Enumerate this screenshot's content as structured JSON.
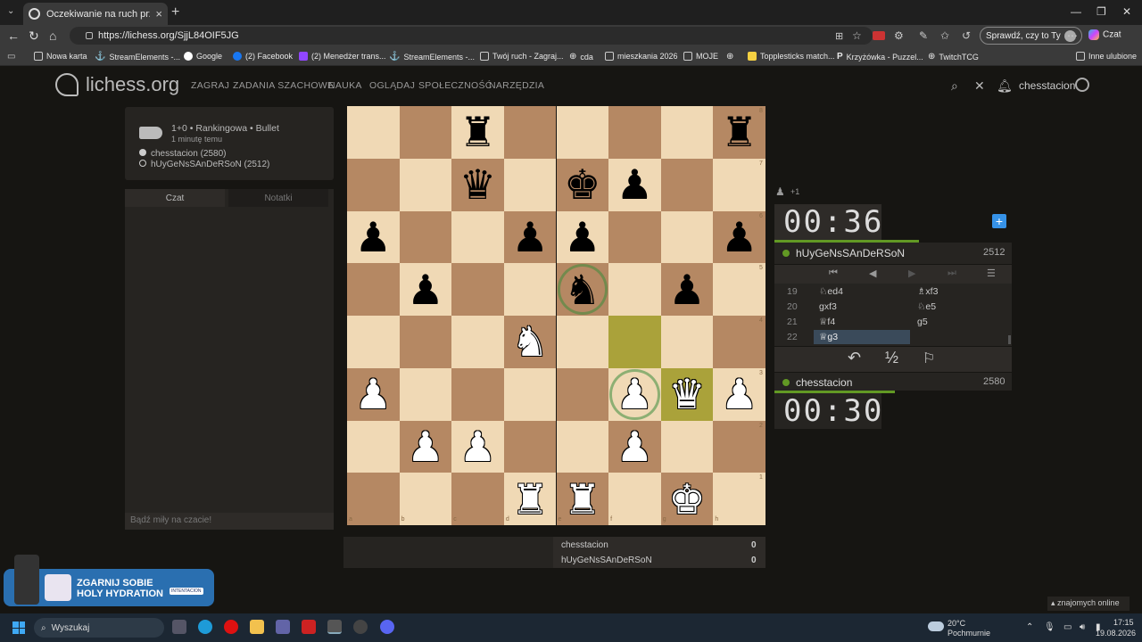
{
  "browser": {
    "tab_title": "Oczekiwanie na ruch przeciwnika",
    "url": "https://lichess.org/SjjL84OIF5JG",
    "sprawdz_label": "Sprawdź, czy to Ty",
    "czat_label": "Czat",
    "bookmarks": [
      "Nowa karta",
      "StreamElements -...",
      "Google",
      "(2) Facebook",
      "(2) Menedżer trans...",
      "StreamElements -...",
      "Twój ruch - Zagraj...",
      "cda",
      "mieszkania 2026",
      "MOJE",
      "",
      "Topplesticks match...",
      "Krzyżówka - Puzzel...",
      "TwitchTCG"
    ],
    "other_bookmarks": "Inne ulubione"
  },
  "site": {
    "logo_text": "lichess.org",
    "nav": [
      "ZAGRAJ",
      "ZADANIA SZACHOWE",
      "NAUKA",
      "OGLĄDAJ",
      "SPOŁECZNOŚĆ",
      "NARZĘDZIA"
    ],
    "username": "chesstacion"
  },
  "game_info": {
    "mode": "1+0 • Rankingowa • Bullet",
    "time_ago": "1 minutę temu",
    "white_player": "chesstacion (2580)",
    "black_player": "hUyGeNsSAnDeRSoN (2512)"
  },
  "chat": {
    "tab_chat": "Czat",
    "tab_notes": "Notatki",
    "placeholder": "Bądź miły na czacie!"
  },
  "board": {
    "files": [
      "a",
      "b",
      "c",
      "d",
      "e",
      "f",
      "g",
      "h"
    ],
    "ranks": [
      "8",
      "7",
      "6",
      "5",
      "4",
      "3",
      "2",
      "1"
    ],
    "pieces": [
      {
        "sq": "c8",
        "p": "♜",
        "c": "b"
      },
      {
        "sq": "h8",
        "p": "♜",
        "c": "b"
      },
      {
        "sq": "c7",
        "p": "♛",
        "c": "b"
      },
      {
        "sq": "e7",
        "p": "♚",
        "c": "b"
      },
      {
        "sq": "f7",
        "p": "♟",
        "c": "b"
      },
      {
        "sq": "a6",
        "p": "♟",
        "c": "b"
      },
      {
        "sq": "d6",
        "p": "♟",
        "c": "b"
      },
      {
        "sq": "e6",
        "p": "♟",
        "c": "b"
      },
      {
        "sq": "h6",
        "p": "♟",
        "c": "b"
      },
      {
        "sq": "b5",
        "p": "♟",
        "c": "b"
      },
      {
        "sq": "e5",
        "p": "♞",
        "c": "b"
      },
      {
        "sq": "g5",
        "p": "♟",
        "c": "b"
      },
      {
        "sq": "d4",
        "p": "♞",
        "c": "w"
      },
      {
        "sq": "a3",
        "p": "♟",
        "c": "w"
      },
      {
        "sq": "f3",
        "p": "♟",
        "c": "w"
      },
      {
        "sq": "g3",
        "p": "♛",
        "c": "w"
      },
      {
        "sq": "h3",
        "p": "♟",
        "c": "w"
      },
      {
        "sq": "b2",
        "p": "♟",
        "c": "w"
      },
      {
        "sq": "c2",
        "p": "♟",
        "c": "w"
      },
      {
        "sq": "f2",
        "p": "♟",
        "c": "w"
      },
      {
        "sq": "d1",
        "p": "♜",
        "c": "w"
      },
      {
        "sq": "e1",
        "p": "♜",
        "c": "w"
      },
      {
        "sq": "g1",
        "p": "♚",
        "c": "w"
      }
    ],
    "highlight": [
      "f4",
      "g3"
    ],
    "rings": [
      "e5",
      "f3"
    ]
  },
  "panel": {
    "material_diff": "+1",
    "top_clock": "00:36",
    "top_player": "hUyGeNsSAnDeRSoN",
    "top_rating": "2512",
    "bottom_clock": "00:30",
    "bottom_player": "chesstacion",
    "bottom_rating": "2580",
    "moves": [
      {
        "n": "19",
        "w": "♘ed4",
        "b": "♗xf3"
      },
      {
        "n": "20",
        "w": "gxf3",
        "b": "♘e5"
      },
      {
        "n": "21",
        "w": "♕f4",
        "b": "g5"
      },
      {
        "n": "22",
        "w": "♕g3",
        "b": ""
      }
    ],
    "draw_label": "½"
  },
  "score": {
    "p1": "chesstacion",
    "s1": "0",
    "p2": "hUyGeNsSAnDeRSoN",
    "s2": "0"
  },
  "friends_online": "znajomych online",
  "ad": {
    "line1": "ZGARNIJ SOBIE",
    "line2": "HOLY HYDRATION",
    "tag": "INTENTACION"
  },
  "taskbar": {
    "search": "Wyszukaj",
    "weather_temp": "20°C",
    "weather_desc": "Pochmurnie",
    "time": "17:15",
    "date": "19.08.2026"
  }
}
